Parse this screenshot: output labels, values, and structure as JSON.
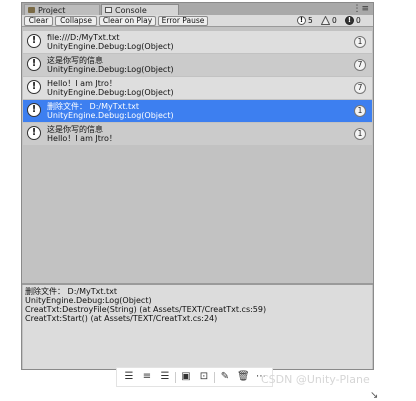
{
  "tabs": [
    {
      "label": "Project",
      "icon": "folder-icon"
    },
    {
      "label": "Console",
      "icon": "console-icon"
    }
  ],
  "toolbar": {
    "clear": "Clear",
    "collapse": "Collapse",
    "clear_on_play": "Clear on Play",
    "error_pause": "Error Pause",
    "info_count": "5",
    "warn_count": "0",
    "error_count": "0"
  },
  "log_entries": [
    {
      "line1": "file:///D:/MyTxt.txt",
      "line2": "UnityEngine.Debug:Log(Object)",
      "count": "1",
      "selected": false
    },
    {
      "line1": "这是你写的信息",
      "line2": "UnityEngine.Debug:Log(Object)",
      "count": "7",
      "selected": false
    },
    {
      "line1": "Hello！I am Jtro！",
      "line2": "UnityEngine.Debug:Log(Object)",
      "count": "7",
      "selected": false
    },
    {
      "line1": "删除文件： D:/MyTxt.txt",
      "line2": "UnityEngine.Debug:Log(Object)",
      "count": "1",
      "selected": true
    },
    {
      "line1": "这是你写的信息",
      "line2": "Hello！I am Jtro！",
      "count": "1",
      "selected": false
    }
  ],
  "details": [
    "删除文件： D:/MyTxt.txt",
    "UnityEngine.Debug:Log(Object)",
    "CreatTxt:DestroyFile(String) (at Assets/TEXT/CreatTxt.cs:59)",
    "CreatTxt:Start() (at Assets/TEXT/CreatTxt.cs:24)"
  ],
  "watermark": "CSDN @Unity-Plane"
}
